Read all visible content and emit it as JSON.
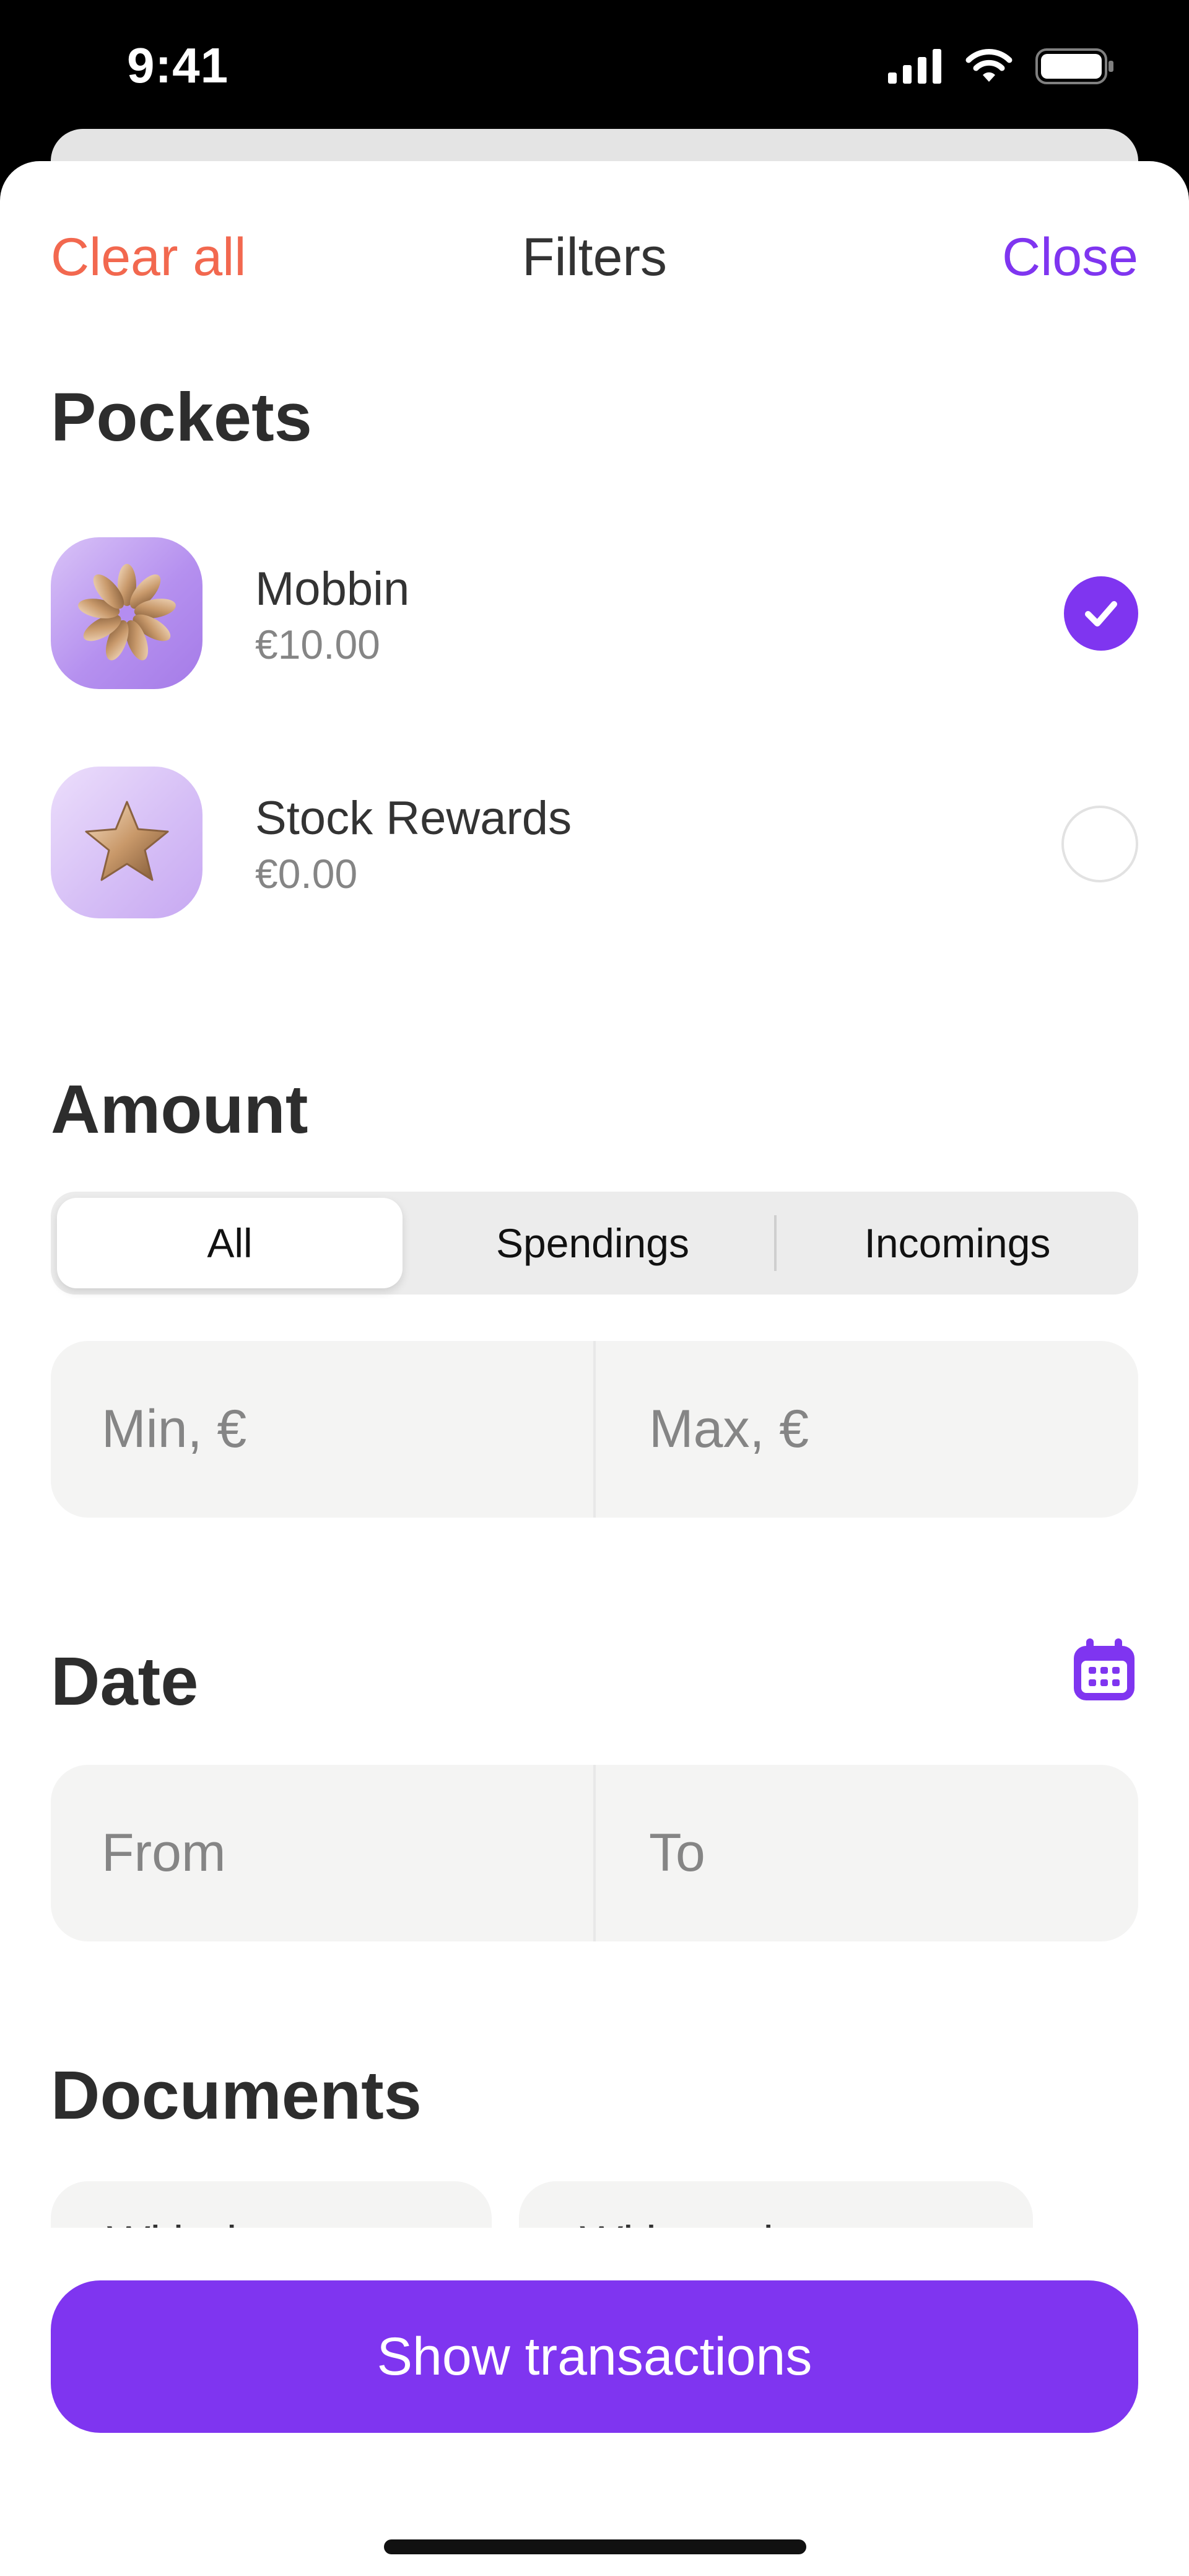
{
  "status_bar": {
    "time": "9:41"
  },
  "nav": {
    "clear_all": "Clear all",
    "title": "Filters",
    "close": "Close"
  },
  "pockets": {
    "title": "Pockets",
    "items": [
      {
        "name": "Mobbin",
        "amount": "€10.00",
        "selected": true,
        "icon": "flower-icon"
      },
      {
        "name": "Stock Rewards",
        "amount": "€0.00",
        "selected": false,
        "icon": "star-icon"
      }
    ]
  },
  "amount": {
    "title": "Amount",
    "segments": [
      "All",
      "Spendings",
      "Incomings"
    ],
    "selected_segment": "All",
    "min_placeholder": "Min, €",
    "max_placeholder": "Max, €"
  },
  "date": {
    "title": "Date",
    "from_placeholder": "From",
    "to_placeholder": "To"
  },
  "documents": {
    "title": "Documents",
    "chips": [
      "With documents",
      "Without documents"
    ]
  },
  "cta": {
    "label": "Show transactions"
  },
  "colors": {
    "accent": "#7f35f0",
    "clear_all": "#f2684f",
    "field_bg": "#f4f4f3"
  }
}
